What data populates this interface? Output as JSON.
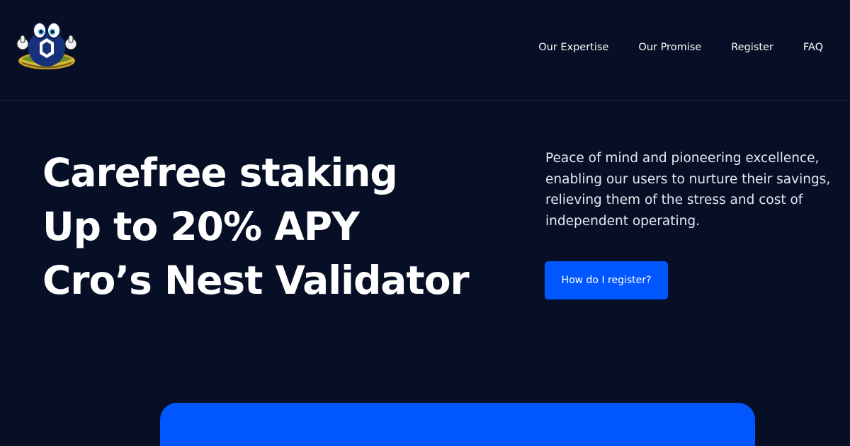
{
  "header": {
    "logo_icon": "nest-mascot-logo",
    "nav": [
      {
        "label": "Our Expertise"
      },
      {
        "label": "Our Promise"
      },
      {
        "label": "Register"
      },
      {
        "label": "FAQ"
      }
    ]
  },
  "hero": {
    "title_lines": [
      "Carefree staking",
      "Up to 20% APY",
      "Cro’s Nest Validator"
    ],
    "description": "Peace of mind and pioneering excellence, enabling our users to nurture their savings, relieving them of the stress and cost of independent operating.",
    "cta_label": "How do I register?"
  },
  "colors": {
    "background": "#070f26",
    "accent": "#0057ff",
    "text": "#ffffff"
  }
}
